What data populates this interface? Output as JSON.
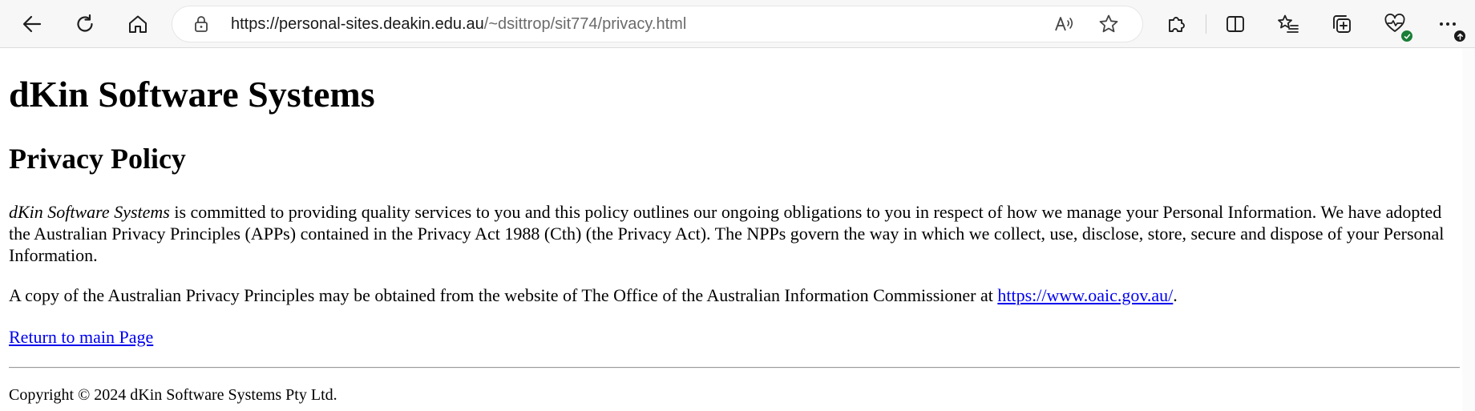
{
  "browser": {
    "url_host": "https://personal-sites.deakin.edu.au",
    "url_path": "/~dsittrop/sit774/privacy.html",
    "icons": {
      "back": "back-arrow-icon",
      "refresh": "refresh-icon",
      "home": "home-icon",
      "site_info": "lock-icon",
      "read_aloud": "read-aloud-icon",
      "favorite": "star-icon",
      "extensions": "puzzle-icon",
      "split_screen": "split-screen-icon",
      "favorites": "favorites-list-icon",
      "collections": "collections-icon",
      "browser_essentials": "heart-pulse-icon",
      "more": "ellipsis-icon"
    },
    "colors": {
      "toolbar_bg": "#f7f7f7",
      "status_green": "#1a7f37",
      "update_badge": "#1a1a1a"
    }
  },
  "page": {
    "site_title": "dKin Software Systems",
    "page_title": "Privacy Policy",
    "intro": {
      "company_name": "dKin Software Systems",
      "text": " is committed to providing quality services to you and this policy outlines our ongoing obligations to you in respect of how we manage your Personal Information. We have adopted the Australian Privacy Principles (APPs) contained in the Privacy Act 1988 (Cth) (the Privacy Act). The NPPs govern the way in which we collect, use, disclose, store, secure and dispose of your Personal Information."
    },
    "app_copy": {
      "text_before": "A copy of the Australian Privacy Principles may be obtained from the website of The Office of the Australian Information Commissioner at ",
      "link_text": "https://www.oaic.gov.au/",
      "text_after": "."
    },
    "return_link": "Return to main Page",
    "copyright": "Copyright © 2024 dKin Software Systems Pty Ltd.",
    "colors": {
      "link": "#0000ee",
      "text": "#000000"
    }
  }
}
